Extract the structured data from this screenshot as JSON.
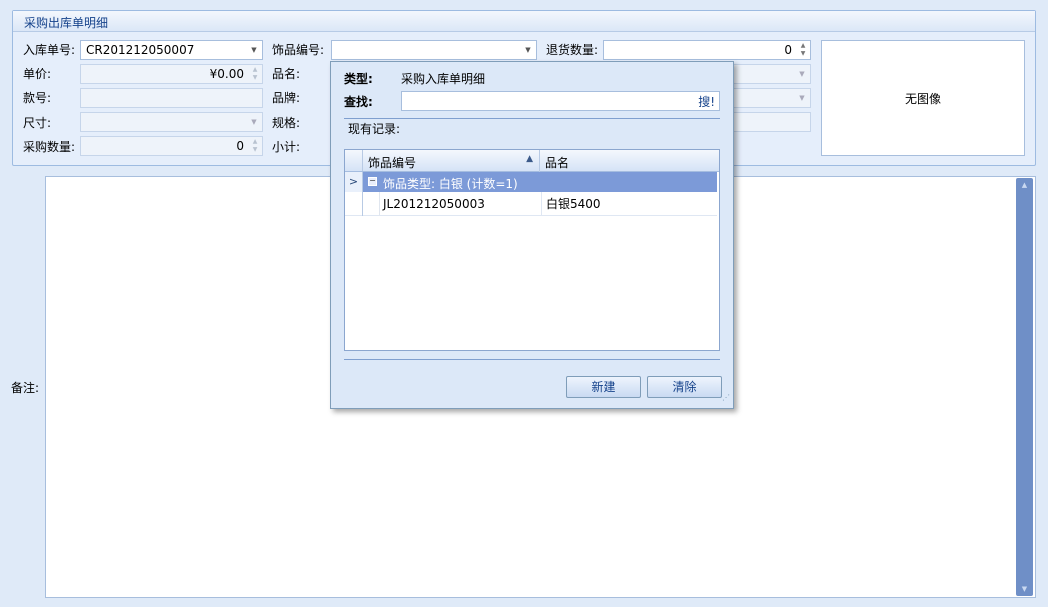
{
  "group": {
    "title": "采购出库单明细"
  },
  "form": {
    "receipt_no_label": "入库单号:",
    "receipt_no_value": "CR201212050007",
    "jewelry_code_label": "饰品编号:",
    "jewelry_code_value": "",
    "return_qty_label": "退货数量:",
    "return_qty_value": "0",
    "unit_price_label": "单价:",
    "unit_price_value": "¥0.00",
    "product_name_label": "品名:",
    "style_no_label": "款号:",
    "brand_label": "品牌:",
    "size_label": "尺寸:",
    "spec_label": "规格:",
    "purchase_qty_label": "采购数量:",
    "purchase_qty_value": "0",
    "subtotal_label": "小计:",
    "no_image": "无图像",
    "remark_label": "备注:"
  },
  "popup": {
    "type_label": "类型:",
    "type_value": "采购入库单明细",
    "search_label": "查找:",
    "search_button": "搜!",
    "records_label": "现有记录:",
    "grid": {
      "columns": [
        "饰品编号",
        "品名"
      ],
      "group_row": "饰品类型: 白银 (计数=1)",
      "rows": [
        {
          "code": "JL201212050003",
          "name": "白银5400"
        }
      ]
    },
    "new_button": "新建",
    "clear_button": "清除"
  },
  "icons": {
    "dropdown": "chevron-down-icon",
    "spin": "spin-updown-icon",
    "row_indicator": "chevron-right-icon",
    "collapse": "collapse-minus-icon",
    "sort": "sort-ascending-icon",
    "grip": "resize-grip-icon"
  },
  "colors": {
    "background": "#dfeaf8",
    "group_row": "#7c9ad8",
    "scrollbar": "#6f8fc7",
    "title_text": "#15428b"
  }
}
